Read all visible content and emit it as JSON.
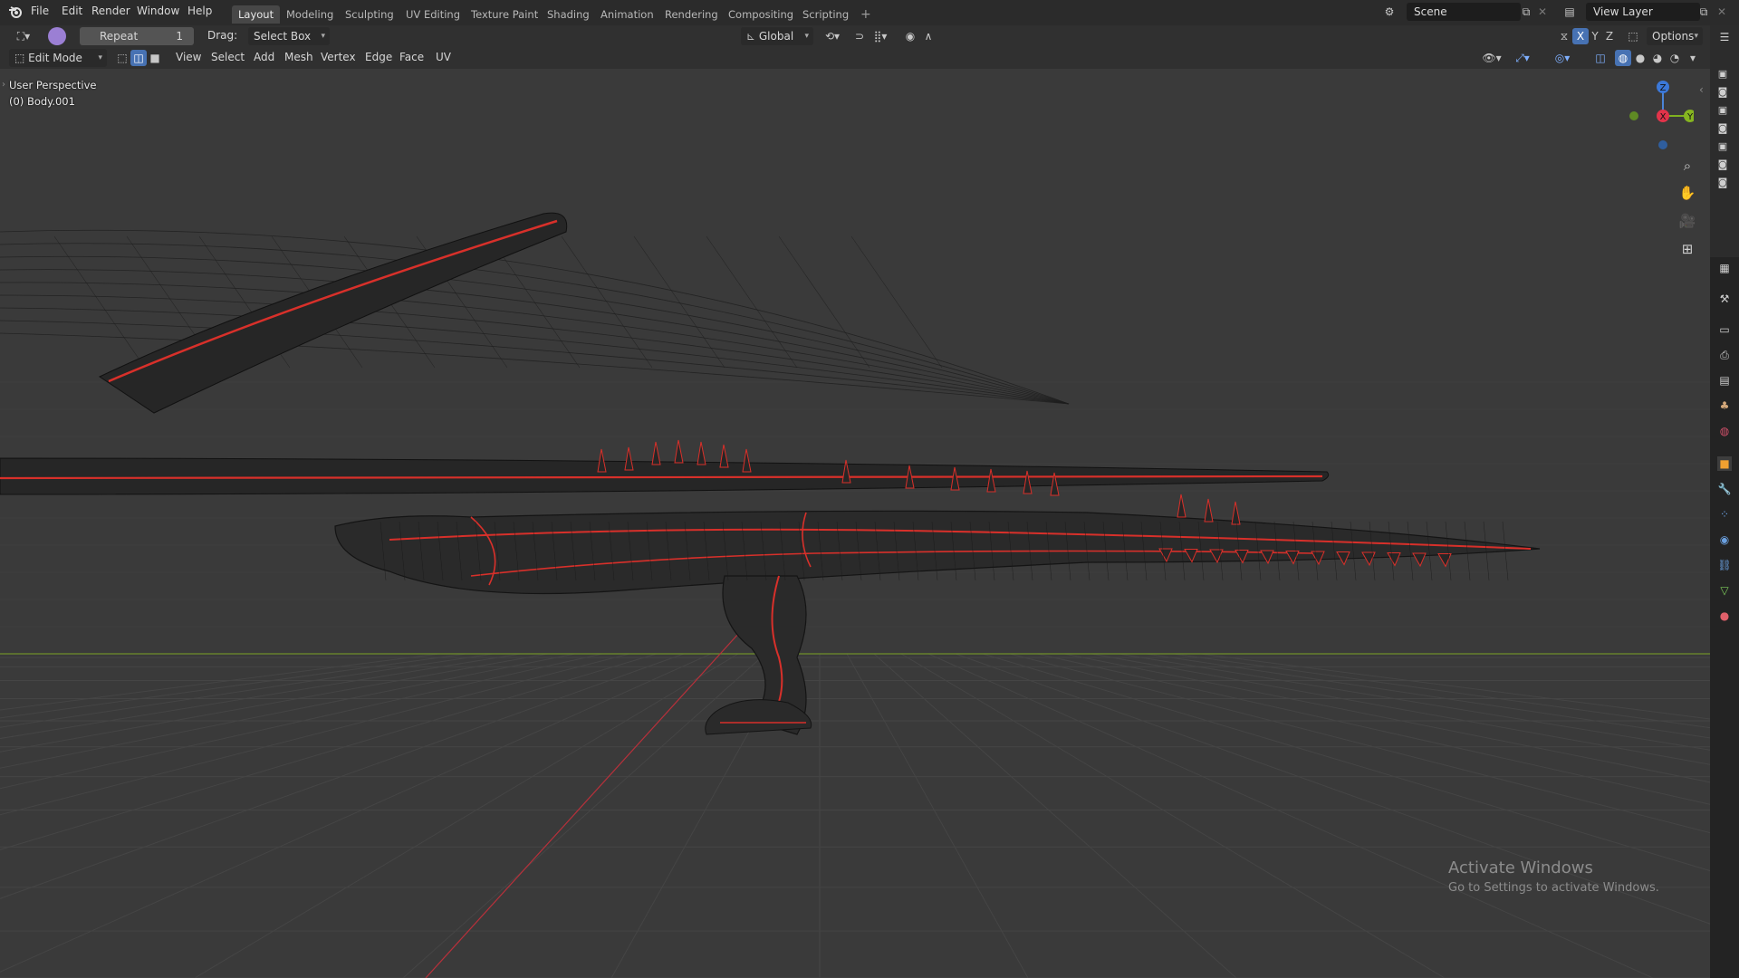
{
  "topbar": {
    "menus": [
      "File",
      "Edit",
      "Render",
      "Window",
      "Help"
    ],
    "workspace_tabs": [
      "Layout",
      "Modeling",
      "Sculpting",
      "UV Editing",
      "Texture Paint",
      "Shading",
      "Animation",
      "Rendering",
      "Compositing",
      "Scripting"
    ],
    "active_tab": "Layout",
    "add_tab_symbol": "+",
    "scene_label": "Scene",
    "view_layer_label": "View Layer"
  },
  "tool_settings": {
    "repeat_label": "Repeat",
    "repeat_value": "1",
    "drag_label": "Drag:",
    "drag_value": "Select Box",
    "transform_orientation": "Global",
    "options_label": "Options",
    "axis_labels": [
      "X",
      "Y",
      "Z"
    ]
  },
  "header": {
    "mode": "Edit Mode",
    "menus": [
      "View",
      "Select",
      "Add",
      "Mesh",
      "Vertex",
      "Edge",
      "Face",
      "UV"
    ]
  },
  "viewport": {
    "perspective_label": "User Perspective",
    "object_label": "(0) Body.001",
    "gizmo_axes": [
      "X",
      "Y",
      "Z"
    ],
    "mesh_color": "#d8302a",
    "grid_color": "#454545",
    "x_axis_color": "#b8303a",
    "y_axis_color": "#6f8f2a"
  },
  "watermark": {
    "title": "Activate Windows",
    "subtitle": "Go to Settings to activate Windows."
  },
  "icons": {
    "navigation": [
      "zoom-icon",
      "hand-pan-icon",
      "camera-icon",
      "grid-ortho-icon"
    ],
    "properties": [
      "tool-icon",
      "render-icon",
      "output-icon",
      "view-layer-icon",
      "scene-icon",
      "world-icon",
      "object-icon",
      "modifier-icon",
      "particles-icon",
      "physics-icon",
      "constraints-icon",
      "data-icon",
      "material-icon"
    ]
  }
}
